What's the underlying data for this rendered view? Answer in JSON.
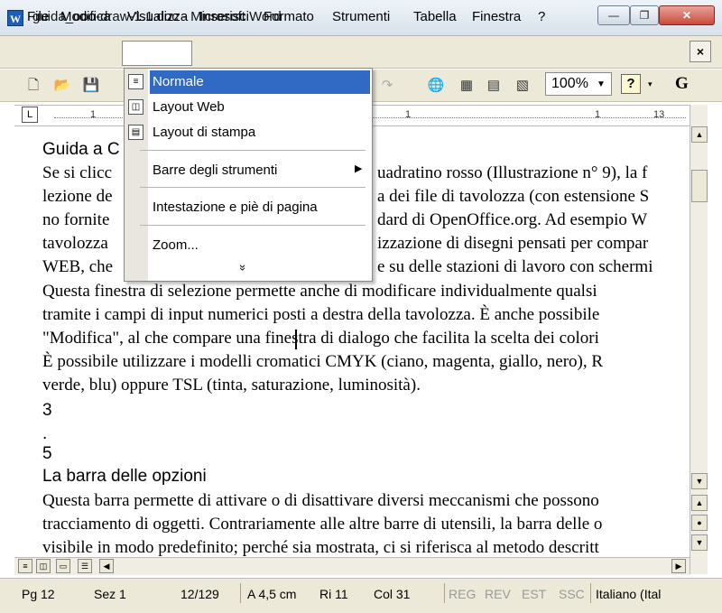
{
  "window": {
    "title": "guida_ooo-draw-1.1.doc - Microsoft Word",
    "app_icon": "W",
    "min_glyph": "—",
    "max_glyph": "❐",
    "close_glyph": "✕"
  },
  "menubar": {
    "items": [
      "File",
      "Modifica",
      "Visualizza",
      "Inserisci",
      "Formato",
      "Strumenti",
      "Tabella",
      "Finestra",
      "?"
    ],
    "doc_close": "×"
  },
  "toolbar": {
    "zoom": "100%",
    "help": "?",
    "font_label": "G"
  },
  "ruler": {
    "numbers": [
      "1",
      "1",
      "1",
      "13"
    ]
  },
  "dropdown": {
    "items": [
      {
        "label": "Normale",
        "icon": "normal-view-icon",
        "highlighted": true
      },
      {
        "label": "Layout Web",
        "icon": "web-layout-icon"
      },
      {
        "label": "Layout di stampa",
        "icon": "print-layout-icon"
      },
      {
        "label": "Barre degli strumenti",
        "submenu": true
      },
      {
        "label": "Intestazione e piè di pagina"
      },
      {
        "label": "Zoom..."
      }
    ],
    "expand": "»"
  },
  "document": {
    "lines": [
      "Guida a C",
      "Se si clicc",
      "lezione de",
      "no fornite",
      "tavolozza",
      "WEB, che",
      "Questa finestra di selezione permette anche di modificare individualmente qualsi",
      "tramite i campi di input numerici posti a destra della tavolozza. È anche possibile",
      "\"Modifica\", al che compare una finestra di dialogo che facilita la scelta dei colori",
      "È possibile utilizzare i modelli cromatici CMYK (ciano, magenta, giallo, nero), R",
      "verde, blu) oppure TSL (tinta, saturazione, luminosità).",
      "3",
      ".",
      "5",
      "La barra delle opzioni",
      "Questa barra permette di attivare o di disattivare diversi meccanismi che possono",
      "tracciamento di oggetti. Contrariamente alle altre barre di utensili, la barra delle o",
      "visibile in modo predefinito; perché sia mostrata, ci si riferisca al metodo descritt"
    ],
    "right_fragments": [
      "uadratino rosso (Illustrazione n° 9), la f",
      "a dei file di tavolozza (con estensione S",
      "dard di OpenOffice.org. Ad esempio W",
      "izzazione di disegni pensati per compar",
      "e su delle stazioni di lavoro con schermi"
    ]
  },
  "statusbar": {
    "pg": "Pg  12",
    "sez": "Sez  1",
    "pages": "12/129",
    "pos": "A  4,5 cm",
    "ri": "Ri  11",
    "col": "Col  31",
    "reg": "REG",
    "rev": "REV",
    "est": "EST",
    "ssc": "SSC",
    "lang": "Italiano (Ital"
  }
}
